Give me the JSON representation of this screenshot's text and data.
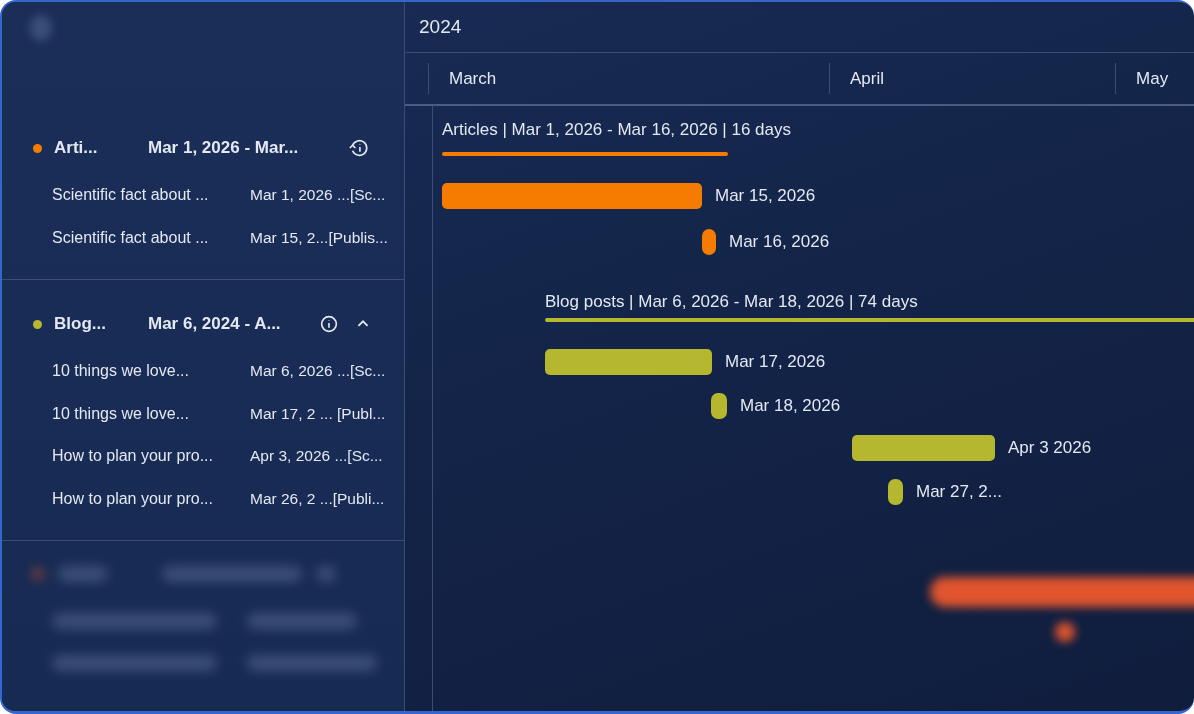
{
  "timeline": {
    "year": "2024",
    "months": [
      "March",
      "April",
      "May"
    ]
  },
  "groups": [
    {
      "kind": "history",
      "name": "Arti...",
      "dates": "Mar 1, 2026 - Mar...",
      "color": "#f57c00",
      "expanded": false,
      "items": [
        {
          "title": "Scientific fact about ...",
          "dates": "Mar 1, 2026 ...[Sc..."
        },
        {
          "title": "Scientific fact about ...",
          "dates": "Mar 15, 2...[Publis..."
        }
      ],
      "summary": "Articles | Mar 1, 2026 - Mar 16, 2026 | 16 days",
      "tasks": [
        {
          "kind": "bar",
          "label": "Mar 15, 2026"
        },
        {
          "kind": "milestone",
          "label": "Mar 16, 2026"
        }
      ]
    },
    {
      "kind": "info",
      "name": "Blog...",
      "dates": "Mar 6, 2024 - A...",
      "color": "#b5b82e",
      "expanded": true,
      "items": [
        {
          "title": "10 things we love...",
          "dates": "Mar 6, 2026 ...[Sc..."
        },
        {
          "title": "10 things we love...",
          "dates": "Mar 17, 2 ... [Publ..."
        },
        {
          "title": "How to plan your pro...",
          "dates": "Apr 3, 2026 ...[Sc..."
        },
        {
          "title": "How to plan your pro...",
          "dates": "Mar 26, 2 ...[Publi..."
        }
      ],
      "summary": "Blog posts | Mar 6, 2026 - Mar 18, 2026 | 74 days",
      "tasks": [
        {
          "kind": "bar",
          "label": "Mar 17, 2026"
        },
        {
          "kind": "milestone",
          "label": "Mar 18, 2026"
        },
        {
          "kind": "bar",
          "label": "Apr 3 2026"
        },
        {
          "kind": "milestone",
          "label": "Mar 27, 2..."
        }
      ]
    },
    {
      "kind": "blurred",
      "color": "#e0552e"
    }
  ]
}
